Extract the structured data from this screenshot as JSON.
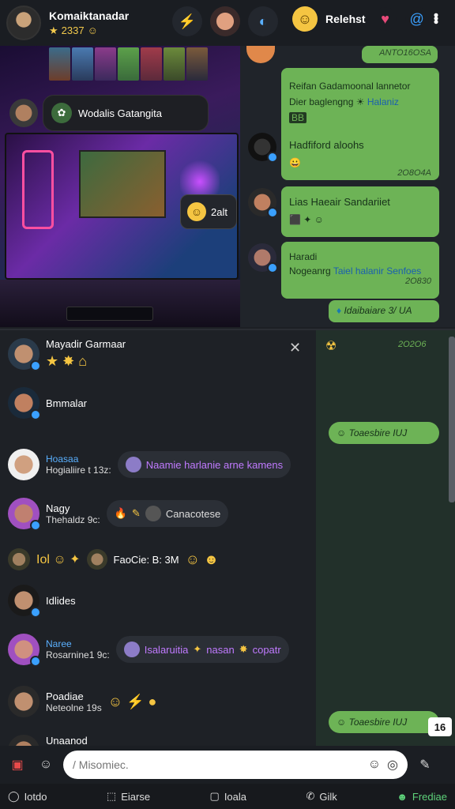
{
  "header": {
    "username": "Komaiktanadar",
    "subtitle": "2337",
    "action_label": "Relehst"
  },
  "media": {
    "tag_label": "Wodalis Gatangita",
    "reaction_label": "2alt"
  },
  "chat_top": {
    "time_first": "ANTO16OSA",
    "msg1_line1": "Reifan Gadamoonal lannetor",
    "msg1_line2": "Dier baglengng",
    "msg1_link": "Halaniz",
    "msg1_tag": "BB",
    "msg2_title": "Hadfiford aloohs",
    "msg2_time": "2O8O4A",
    "msg3_title": "Lias Haeair Sandariiet",
    "msg4_title": "Haradi",
    "msg4_line": "Nogeanrg",
    "msg4_link": "Taiel halanir Senfoes",
    "msg4_time": "2O830",
    "msg5": "Idaibaiare 3/ UA"
  },
  "members": {
    "header_name": "Mayadir Garmaar",
    "items": [
      {
        "name": "Bmmalar"
      },
      {
        "name": "Hoasaa",
        "status": "Hogialiire t 13z:",
        "chip": "Naamie harlanie arne kamens"
      },
      {
        "name": "Nagy",
        "status": "Thehaldz 9c:",
        "chip": "Canacotese"
      },
      {
        "name": "FaoCie: B: 3M"
      },
      {
        "name": "Idlides"
      },
      {
        "name": "Naree",
        "status": "Rosarnine1 9c:",
        "chip": "Isalaruitia",
        "chip_tail": "nasan",
        "chip_end": "copatr"
      },
      {
        "name": "Poadiae",
        "status": "Neteolne 19s"
      },
      {
        "name": "Unaanod"
      }
    ]
  },
  "right_col": {
    "time_top": "2O2O6",
    "bubble1": "Toaesbire IUJ",
    "bubble2": "Toaesbire IUJ",
    "badge_num": "16"
  },
  "composer": {
    "placeholder": "/ Misomiec."
  },
  "bottom_nav": {
    "item1": "Iotdo",
    "item2": "Eiarse",
    "item3": "Ioala",
    "item4": "Gilk",
    "item5": "Frediae"
  }
}
